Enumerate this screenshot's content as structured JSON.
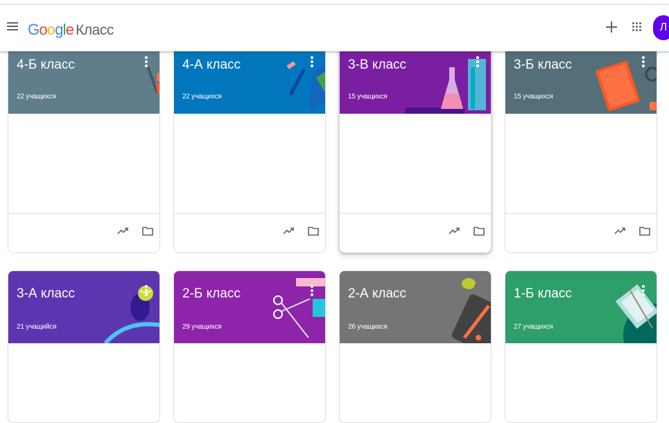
{
  "app": {
    "brand_google": [
      "G",
      "o",
      "o",
      "g",
      "l",
      "e"
    ],
    "brand_suffix": "Класс",
    "avatar_letter": "Л"
  },
  "icons": {
    "menu": "hamburger-menu-icon",
    "add": "plus-icon",
    "apps": "apps-grid-icon",
    "stats": "trending-up-icon",
    "folder": "folder-icon",
    "more": "more-vert-icon"
  },
  "classes": [
    {
      "name": "4-Б класс",
      "students": "22 учащихся",
      "color": "#607d8b"
    },
    {
      "name": "4-А класс",
      "students": "22 учащихся",
      "color": "#0277bd"
    },
    {
      "name": "3-В класс",
      "students": "15 учащихся",
      "color": "#7b1fa2"
    },
    {
      "name": "3-Б класс",
      "students": "15 учащихся",
      "color": "#546e7a"
    },
    {
      "name": "3-А класс",
      "students": "21 учащийся",
      "color": "#5e35b1"
    },
    {
      "name": "2-Б класс",
      "students": "29 учащихся",
      "color": "#8e24aa"
    },
    {
      "name": "2-А класс",
      "students": "26 учащихся",
      "color": "#757575"
    },
    {
      "name": "1-Б класс",
      "students": "27 учащихся",
      "color": "#2e9e6b"
    }
  ]
}
